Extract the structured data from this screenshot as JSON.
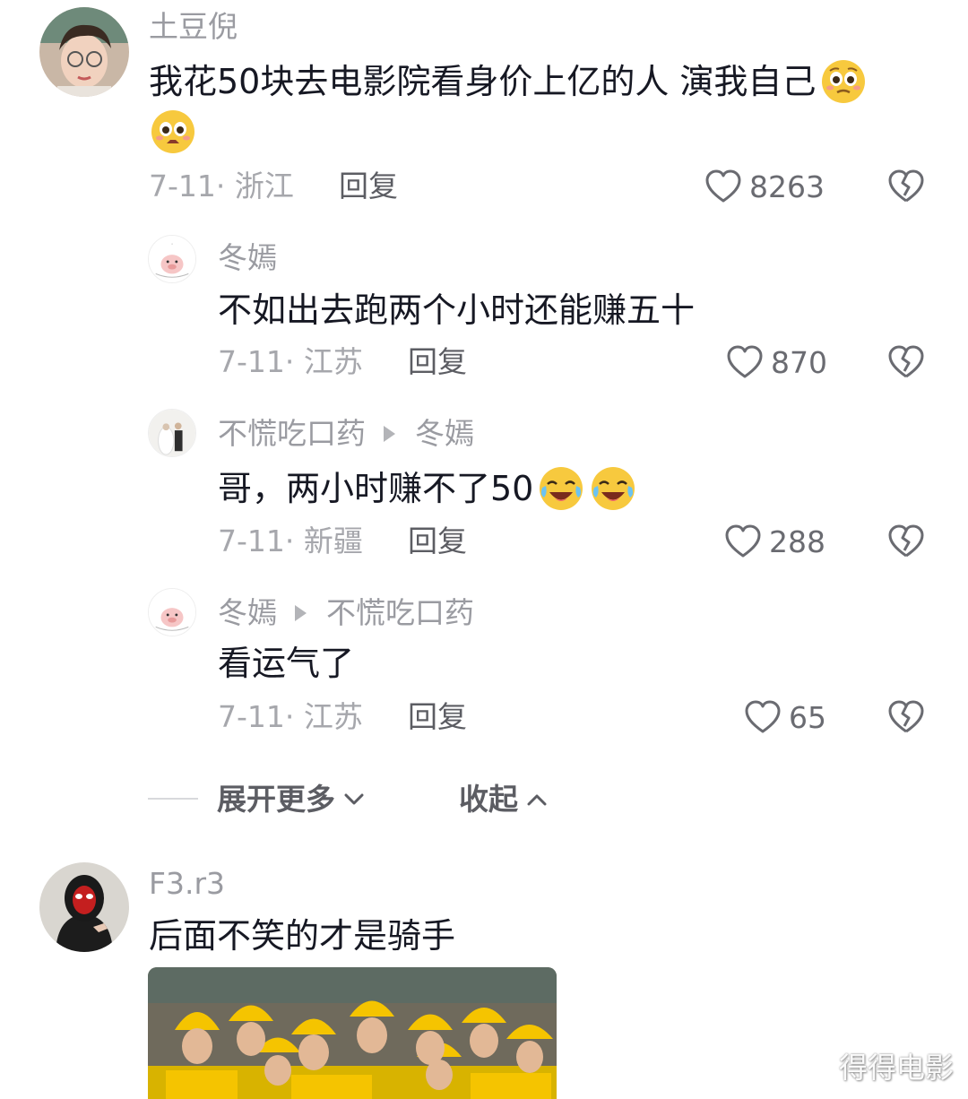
{
  "comments": [
    {
      "username": "土豆倪",
      "content": "我花50块去电影院看身价上亿的人 演我自己",
      "emoji": "pleading-face-emoji",
      "meta": "7-11· 浙江",
      "reply_label": "回复",
      "likes": "8263"
    },
    {
      "username": "F3.r3",
      "content": "后面不笑的才是骑手",
      "image": "photo-of-smiling-delivery-riders"
    }
  ],
  "replies": [
    {
      "username": "冬嫣",
      "content": "不如出去跑两个小时还能赚五十",
      "meta": "7-11· 江苏",
      "reply_label": "回复",
      "likes": "870"
    },
    {
      "username": "不慌吃口药",
      "reply_to": "冬嫣",
      "content": "哥，两小时赚不了50",
      "emoji": "laughing-crying-emoji",
      "meta": "7-11· 新疆",
      "reply_label": "回复",
      "likes": "288"
    },
    {
      "username": "冬嫣",
      "reply_to": "不慌吃口药",
      "content": "看运气了",
      "meta": "7-11· 江苏",
      "reply_label": "回复",
      "likes": "65"
    }
  ],
  "thread_controls": {
    "expand_more": "展开更多",
    "collapse": "收起"
  },
  "watermark": "得得电影",
  "colors": {
    "text_primary": "#161823",
    "text_secondary": "#9a9ba1",
    "delivery_yellow": "#f5c400"
  }
}
